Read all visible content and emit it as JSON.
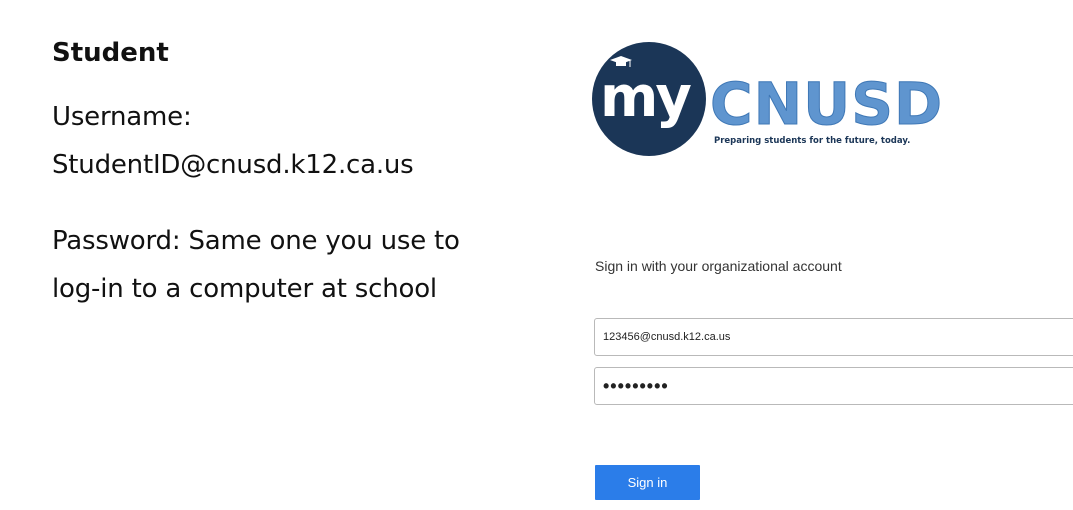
{
  "instructions": {
    "title": "Student",
    "username_label": "Username:",
    "username_value": "StudentID@cnusd.k12.ca.us",
    "password_line1": "Password: Same one you use to",
    "password_line2": "log-in to a computer at school"
  },
  "logo": {
    "my": "my",
    "brand": "CNUSD",
    "tagline": "Preparing students for the future, today."
  },
  "signin": {
    "heading": "Sign in with your organizational account",
    "username_value": "123456@cnusd.k12.ca.us",
    "password_value": "•••••••••",
    "button_label": "Sign in"
  },
  "colors": {
    "logo_navy": "#1b3657",
    "logo_blue": "#5f95cf",
    "button_blue": "#2b7de9"
  }
}
